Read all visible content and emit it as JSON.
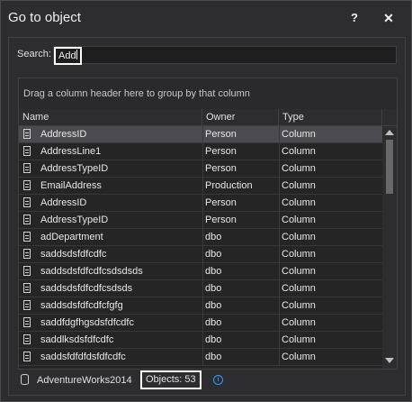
{
  "window": {
    "title": "Go to object",
    "help_label": "?",
    "close_label": "✕"
  },
  "search": {
    "label": "Search:",
    "value": "Add"
  },
  "grid": {
    "group_hint": "Drag a column header here to group by that column",
    "columns": {
      "name": "Name",
      "owner": "Owner",
      "type": "Type"
    },
    "rows": [
      {
        "name": "AddressID",
        "owner": "Person",
        "type": "Column",
        "selected": true
      },
      {
        "name": "AddressLine1",
        "owner": "Person",
        "type": "Column"
      },
      {
        "name": "AddressTypeID",
        "owner": "Person",
        "type": "Column"
      },
      {
        "name": "EmailAddress",
        "owner": "Production",
        "type": "Column"
      },
      {
        "name": "AddressID",
        "owner": "Person",
        "type": "Column"
      },
      {
        "name": "AddressTypeID",
        "owner": "Person",
        "type": "Column"
      },
      {
        "name": "adDepartment",
        "owner": "dbo",
        "type": "Column"
      },
      {
        "name": "saddsdsfdfcdfc",
        "owner": "dbo",
        "type": "Column"
      },
      {
        "name": "saddsdsfdfcdfcsdsdsds",
        "owner": "dbo",
        "type": "Column"
      },
      {
        "name": "saddsdsfdfcdfcsdsds",
        "owner": "dbo",
        "type": "Column"
      },
      {
        "name": "saddsdsfdfcdfcfgfg",
        "owner": "dbo",
        "type": "Column"
      },
      {
        "name": "saddfdgfhgsdsfdfcdfc",
        "owner": "dbo",
        "type": "Column"
      },
      {
        "name": "saddlksdsfdfcdfc",
        "owner": "dbo",
        "type": "Column"
      },
      {
        "name": "saddsfdfdfdsfdfcdfc",
        "owner": "dbo",
        "type": "Column"
      }
    ]
  },
  "status": {
    "database": "AdventureWorks2014",
    "objects": "Objects: 53",
    "info_icon": "i"
  }
}
